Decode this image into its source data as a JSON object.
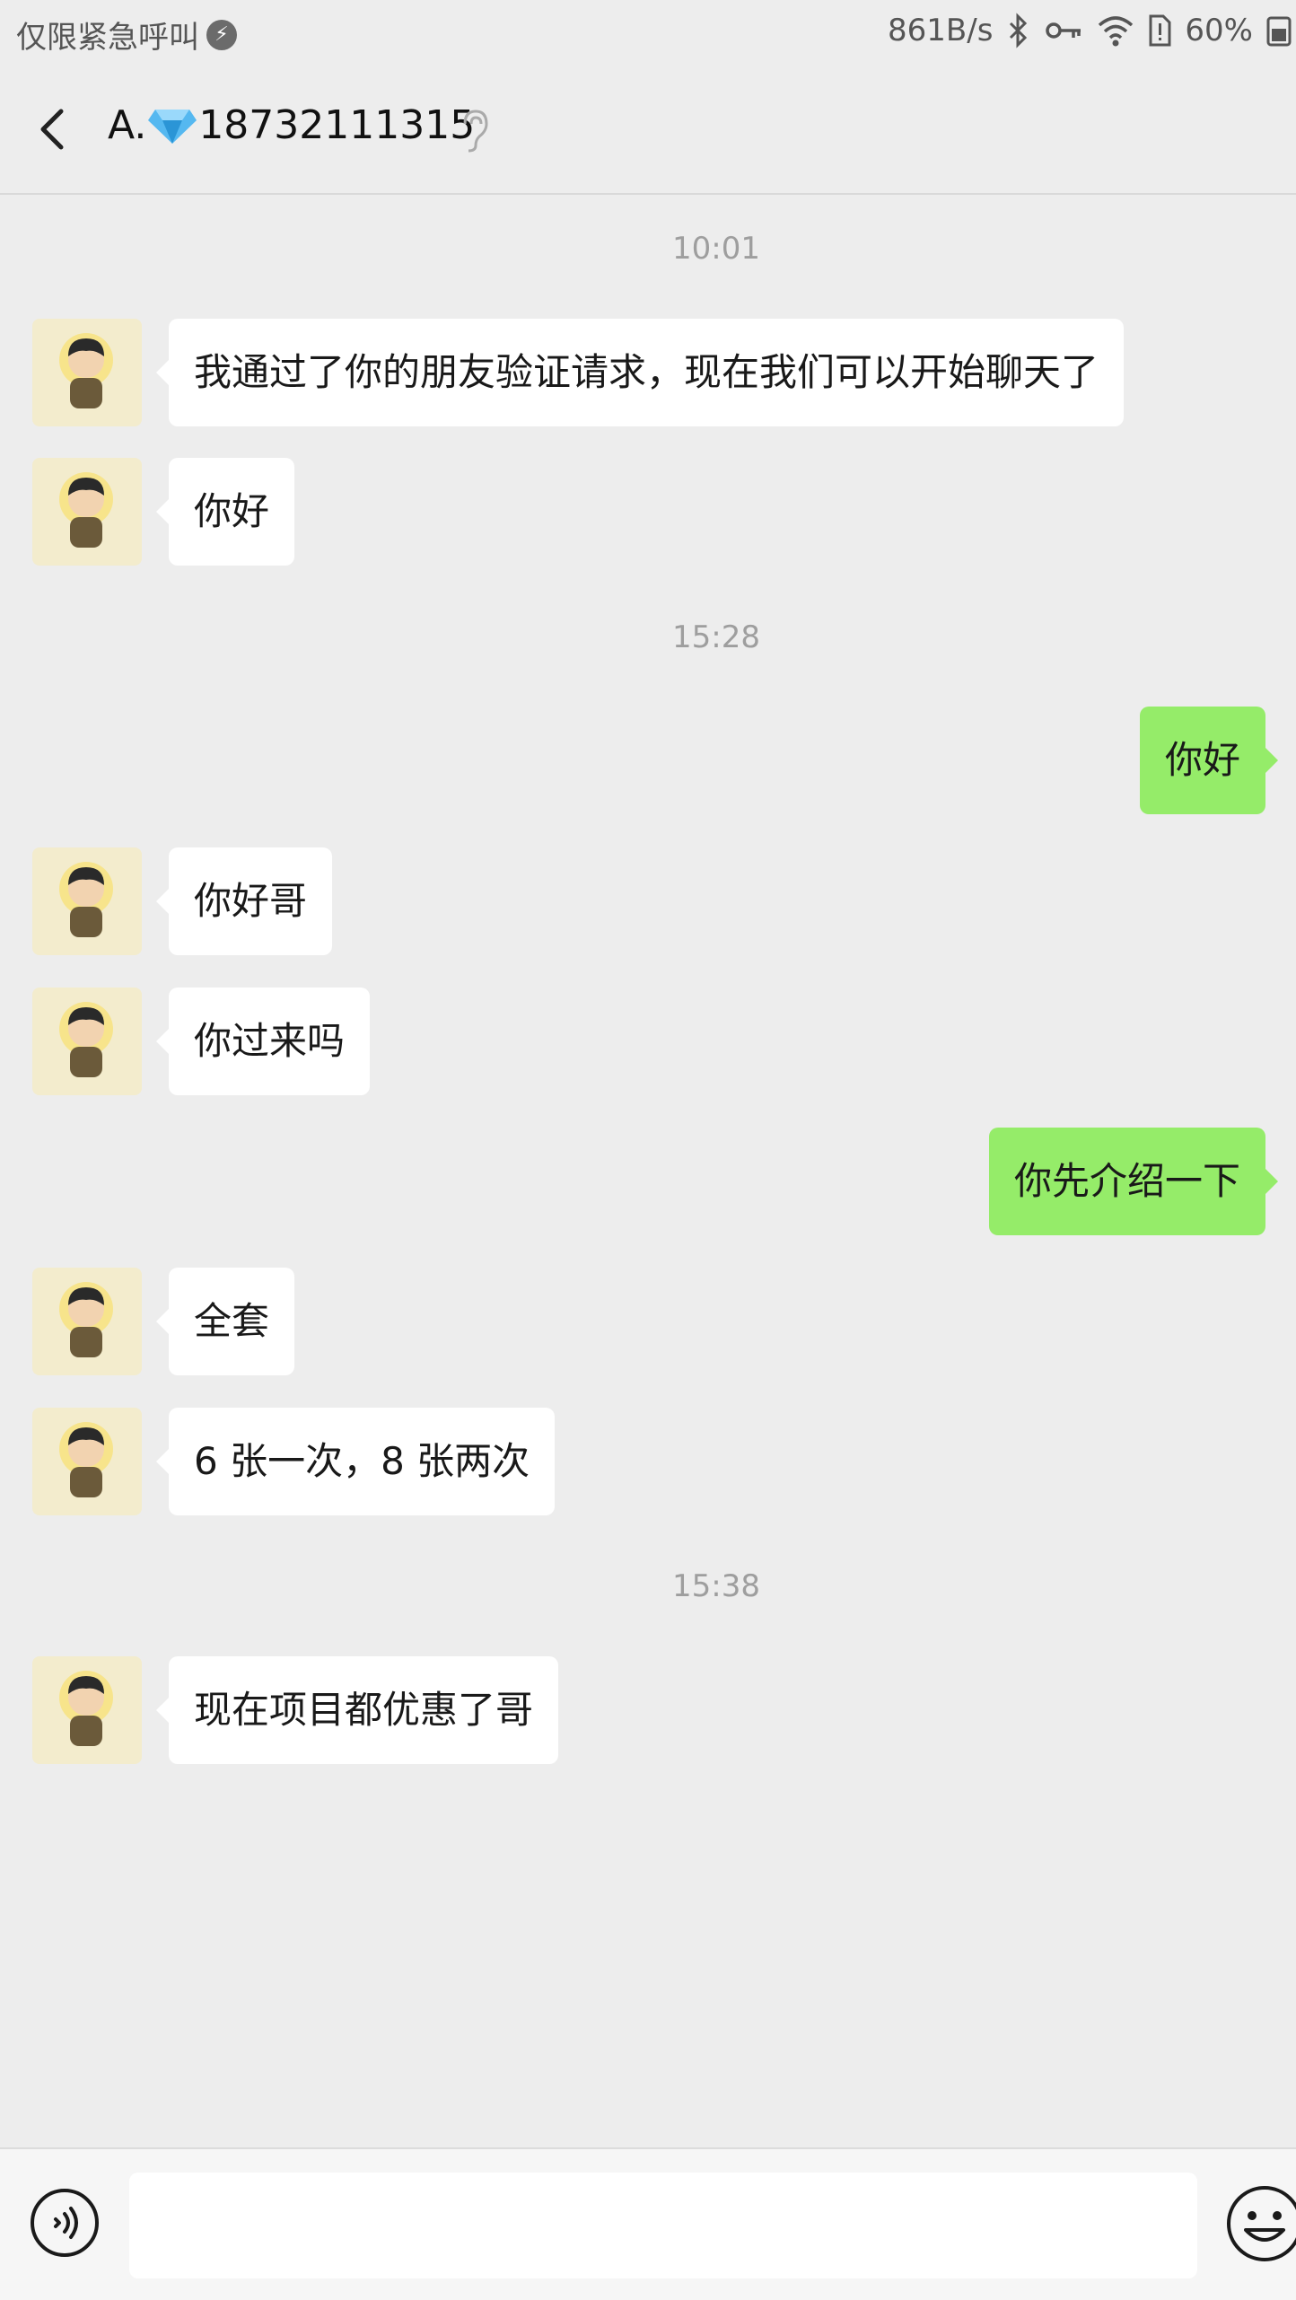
{
  "status_bar": {
    "carrier_text": "仅限紧急呼叫",
    "network_speed": "861B/s",
    "battery_percent": "60%",
    "icons": [
      "bolt-icon",
      "bluetooth-icon",
      "key-icon",
      "wifi-icon",
      "sim-alert-icon",
      "battery-icon"
    ]
  },
  "header": {
    "title_prefix": "A.",
    "title_emoji": "diamond-icon",
    "title_number": "18732111315",
    "icons": [
      "back-icon",
      "ear-icon"
    ]
  },
  "messages": [
    {
      "type": "time",
      "text": "10:01"
    },
    {
      "type": "in",
      "text": "我通过了你的朋友验证请求，现在我们可以开始聊天了"
    },
    {
      "type": "in",
      "text": "你好"
    },
    {
      "type": "time",
      "text": "15:28"
    },
    {
      "type": "out",
      "text": "你好"
    },
    {
      "type": "in",
      "text": "你好哥"
    },
    {
      "type": "in",
      "text": "你过来吗"
    },
    {
      "type": "out",
      "text": "你先介绍一下"
    },
    {
      "type": "in",
      "text": "全套"
    },
    {
      "type": "in",
      "text": "6 张一次，8 张两次"
    },
    {
      "type": "time",
      "text": "15:38"
    },
    {
      "type": "in",
      "text": "现在项目都优惠了哥"
    }
  ],
  "input_bar": {
    "message_value": "",
    "icons": [
      "voice-icon",
      "emoji-icon"
    ]
  },
  "colors": {
    "background": "#ededed",
    "incoming_bubble": "#ffffff",
    "outgoing_bubble": "#95ec69",
    "timestamp": "#9e9e9e"
  }
}
